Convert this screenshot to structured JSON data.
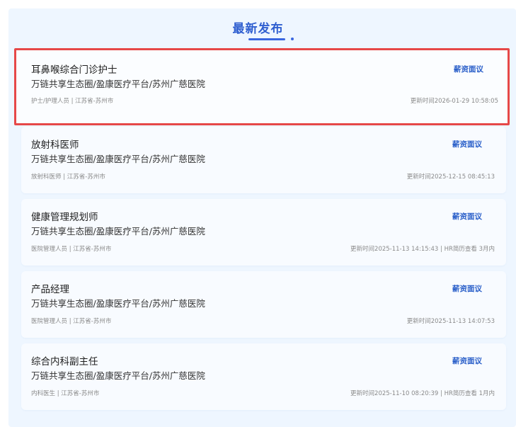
{
  "section": {
    "title": "最新发布"
  },
  "colors": {
    "accent": "#2f5fd0",
    "salary": "#2a5fc9",
    "highlight_border": "#e64848",
    "panel_bg": "#eef6ff",
    "card_bg": "#f8fbff"
  },
  "jobs": [
    {
      "title": "耳鼻喉综合门诊护士",
      "company": "万链共享生态圈/盈康医疗平台/苏州广慈医院",
      "meta": "护士/护理人员 | 江苏省-苏州市",
      "salary": "薪资面议",
      "updated": "更新时间2026-01-29 10:58:05",
      "highlighted": true
    },
    {
      "title": "放射科医师",
      "company": "万链共享生态圈/盈康医疗平台/苏州广慈医院",
      "meta": "放射科医师 | 江苏省-苏州市",
      "salary": "薪资面议",
      "updated": "更新时间2025-12-15 08:45:13",
      "highlighted": false
    },
    {
      "title": "健康管理规划师",
      "company": "万链共享生态圈/盈康医疗平台/苏州广慈医院",
      "meta": "医院管理人员 | 江苏省-苏州市",
      "salary": "薪资面议",
      "updated": "更新时间2025-11-13 14:15:43 | HR简历查看 3月内",
      "highlighted": false
    },
    {
      "title": "产品经理",
      "company": "万链共享生态圈/盈康医疗平台/苏州广慈医院",
      "meta": "医院管理人员 | 江苏省-苏州市",
      "salary": "薪资面议",
      "updated": "更新时间2025-11-13 14:07:53",
      "highlighted": false
    },
    {
      "title": "综合内科副主任",
      "company": "万链共享生态圈/盈康医疗平台/苏州广慈医院",
      "meta": "内科医生 | 江苏省-苏州市",
      "salary": "薪资面议",
      "updated": "更新时间2025-11-10 08:20:39 | HR简历查看 1月内",
      "highlighted": false
    }
  ]
}
